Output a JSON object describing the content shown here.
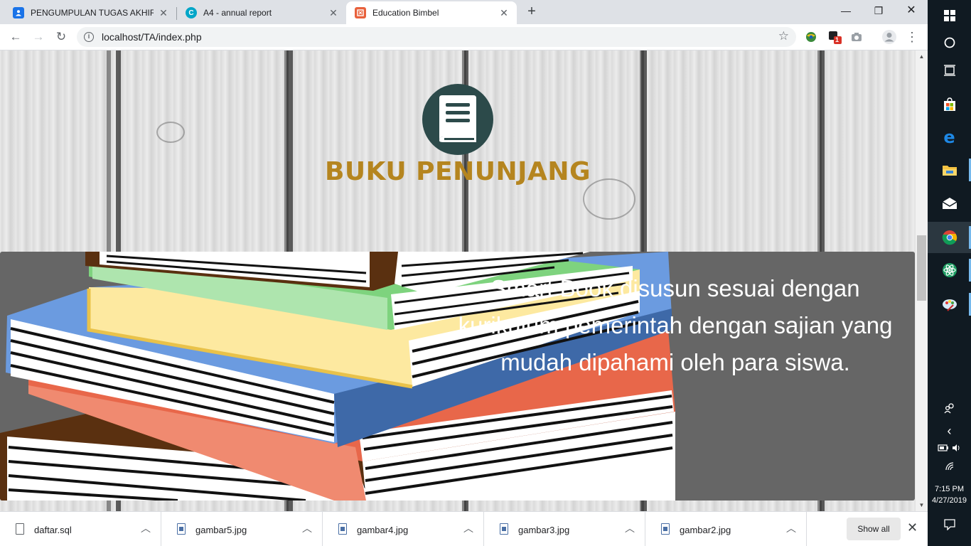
{
  "browser": {
    "tabs": [
      {
        "title": "PENGUMPULAN TUGAS AKHIR W",
        "icon": "person-doc-icon",
        "color": "#1a73e8"
      },
      {
        "title": "A4 - annual report",
        "icon": "canva-icon",
        "color": "#00a6c8"
      },
      {
        "title": "Education Bimbel",
        "icon": "site-icon",
        "color": "#e8613c"
      }
    ],
    "url": "localhost/TA/index.php"
  },
  "page": {
    "heading": "BUKU PENUNJANG",
    "hero_text": "Smart Book disusun sesuai dengan kurikulum pemerintah dengan sajian yang mudah dipahami oleh para siswa.",
    "colors": {
      "heading": "#b5851f",
      "logo_circle": "#2c4a4a",
      "hero_bg": "#666666"
    }
  },
  "downloads": {
    "items": [
      {
        "name": "daftar.sql",
        "type": "file"
      },
      {
        "name": "gambar5.jpg",
        "type": "image"
      },
      {
        "name": "gambar4.jpg",
        "type": "image"
      },
      {
        "name": "gambar3.jpg",
        "type": "image"
      },
      {
        "name": "gambar2.jpg",
        "type": "image"
      }
    ],
    "show_all_label": "Show all"
  },
  "extensions": {
    "badge_count": "1"
  },
  "taskbar": {
    "time": "7:15 PM",
    "date": "4/27/2019"
  }
}
